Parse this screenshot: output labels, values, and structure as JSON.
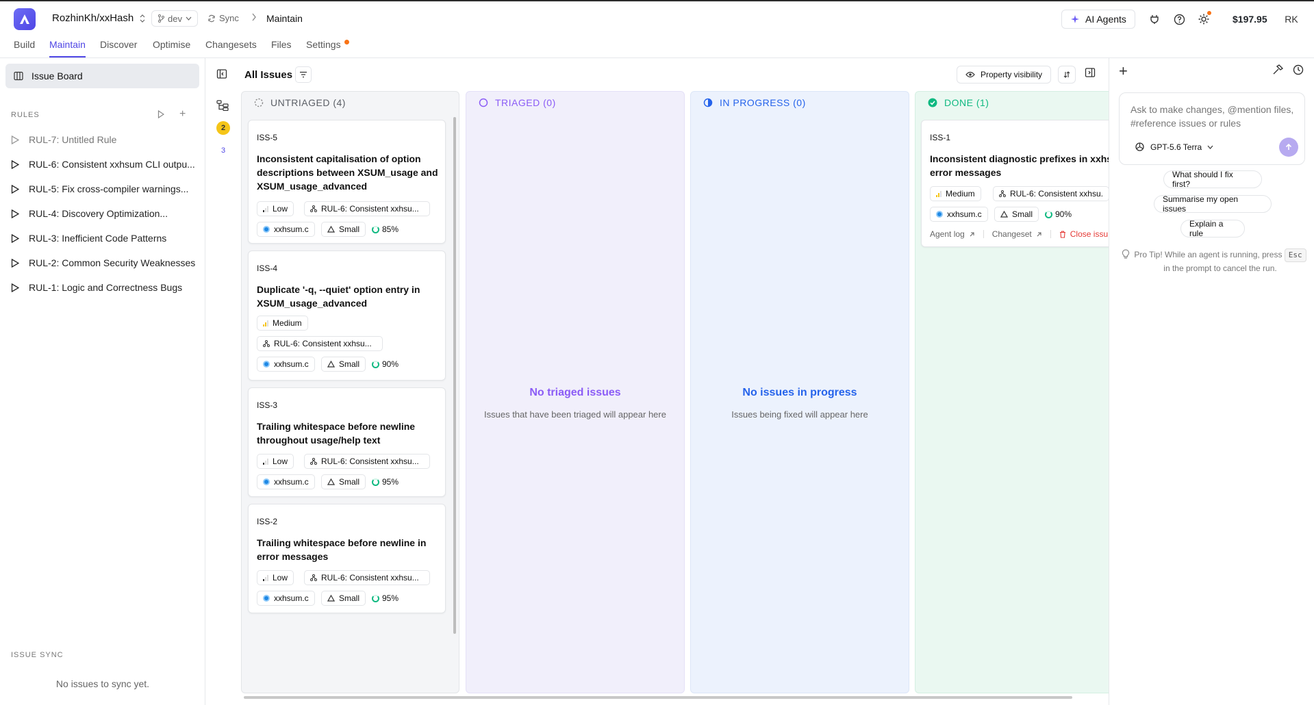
{
  "header": {
    "repo": "RozhinKh/xxHash",
    "branch": "dev",
    "sync_label": "Sync",
    "breadcrumb": "Maintain",
    "ai_agents_label": "AI Agents",
    "balance": "$197.95",
    "avatar_initials": "RK"
  },
  "tabs": [
    "Build",
    "Maintain",
    "Discover",
    "Optimise",
    "Changesets",
    "Files",
    "Settings"
  ],
  "active_tab": "Maintain",
  "sidebar": {
    "issue_board_label": "Issue Board",
    "rules_heading": "RULES",
    "rules": [
      "RUL-7: Untitled Rule",
      "RUL-6: Consistent xxhsum CLI outpu...",
      "RUL-5: Fix cross-compiler warnings...",
      "RUL-4: Discovery Optimization...",
      "RUL-3: Inefficient Code Patterns",
      "RUL-2: Common Security Weaknesses",
      "RUL-1: Logic and Correctness Bugs"
    ],
    "issue_sync_heading": "ISSUE SYNC",
    "issue_sync_empty": "No issues to sync yet."
  },
  "board": {
    "title": "All Issues",
    "property_visibility_label": "Property visibility",
    "side_badges": [
      "2",
      "3"
    ],
    "columns": {
      "untriaged": {
        "label": "UNTRIAGED (4)",
        "color": "#5b5f66"
      },
      "triaged": {
        "label": "TRIAGED (0)",
        "color": "#8b5cf6",
        "empty_title": "No triaged issues",
        "empty_sub": "Issues that have been triaged will appear here"
      },
      "in_progress": {
        "label": "IN PROGRESS (0)",
        "color": "#2563eb",
        "empty_title": "No issues in progress",
        "empty_sub": "Issues being fixed will appear here"
      },
      "done": {
        "label": "DONE (1)",
        "color": "#10b981"
      }
    },
    "cards": [
      {
        "id": "ISS-5",
        "title": "Inconsistent capitalisation of option descriptions between XSUM_usage and XSUM_usage_advanced",
        "priority": "Low",
        "rule": "RUL-6: Consistent xxhsu...",
        "file": "xxhsum.c",
        "size": "Small",
        "confidence": "85%"
      },
      {
        "id": "ISS-4",
        "title": "Duplicate '-q, --quiet' option entry in XSUM_usage_advanced",
        "priority": "Medium",
        "rule": "RUL-6: Consistent xxhsu...",
        "file": "xxhsum.c",
        "size": "Small",
        "confidence": "90%"
      },
      {
        "id": "ISS-3",
        "title": "Trailing whitespace before newline throughout usage/help text",
        "priority": "Low",
        "rule": "RUL-6: Consistent xxhsu...",
        "file": "xxhsum.c",
        "size": "Small",
        "confidence": "95%"
      },
      {
        "id": "ISS-2",
        "title": "Trailing whitespace before newline in error messages",
        "priority": "Low",
        "rule": "RUL-6: Consistent xxhsu...",
        "file": "xxhsum.c",
        "size": "Small",
        "confidence": "95%"
      }
    ],
    "done_card": {
      "id": "ISS-1",
      "title": "Inconsistent diagnostic prefixes in xxhs error messages",
      "priority": "Medium",
      "rule": "RUL-6: Consistent xxhsu.",
      "file": "xxhsum.c",
      "size": "Small",
      "confidence": "90%",
      "agent_log": "Agent log",
      "changeset": "Changeset",
      "close": "Close issu"
    }
  },
  "assistant": {
    "placeholder": "Ask to make changes, @mention files, #reference issues or rules",
    "model": "GPT-5.6 Terra",
    "suggestions": [
      "What should I fix first?",
      "Summarise my open issues",
      "Explain a rule"
    ],
    "protip_before": "Pro Tip! While an agent is running, press",
    "protip_key": "Esc",
    "protip_after": "in the prompt to cancel the run."
  },
  "colors": {
    "accent": "#4f46e5",
    "badge_yellow": "#f5c518",
    "close_red": "#e53935"
  }
}
